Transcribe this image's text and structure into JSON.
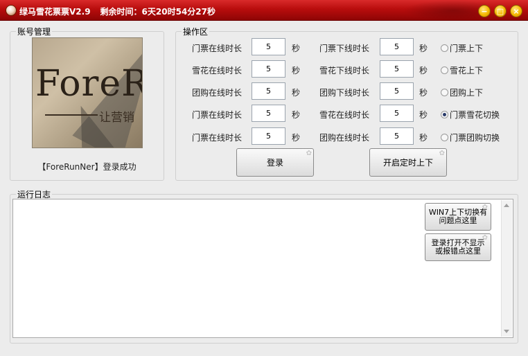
{
  "titlebar": {
    "app_name": "绿马雪花票票V2.9",
    "remaining": "剩余时间：6天20时54分27秒",
    "min_glyph": "−",
    "max_glyph": "□",
    "close_glyph": "×"
  },
  "account": {
    "legend": "账号管理",
    "logo_text": "ForeR",
    "logo_subtext": "让营销",
    "status": "【ForeRunNer】登录成功"
  },
  "operations": {
    "legend": "操作区",
    "unit": "秒",
    "rows": [
      {
        "left_label": "门票在线时长",
        "left_value": "5",
        "right_label": "门票下线时长",
        "right_value": "5",
        "option": "门票上下",
        "checked": false
      },
      {
        "left_label": "雪花在线时长",
        "left_value": "5",
        "right_label": "雪花下线时长",
        "right_value": "5",
        "option": "雪花上下",
        "checked": false
      },
      {
        "left_label": "团购在线时长",
        "left_value": "5",
        "right_label": "团购下线时长",
        "right_value": "5",
        "option": "团购上下",
        "checked": false
      },
      {
        "left_label": "门票在线时长",
        "left_value": "5",
        "right_label": "雪花在线时长",
        "right_value": "5",
        "option": "门票雪花切换",
        "checked": true
      },
      {
        "left_label": "门票在线时长",
        "left_value": "5",
        "right_label": "团购在线时长",
        "right_value": "5",
        "option": "门票团购切换",
        "checked": false
      }
    ],
    "login_button": "登录",
    "timer_button": "开启定时上下"
  },
  "log": {
    "legend": "运行日志",
    "content": "",
    "win7_button_line1": "WIN7上下切换有",
    "win7_button_line2": "问题点这里",
    "help_button_line1": "登录打开不显示",
    "help_button_line2": "或报错点这里"
  }
}
